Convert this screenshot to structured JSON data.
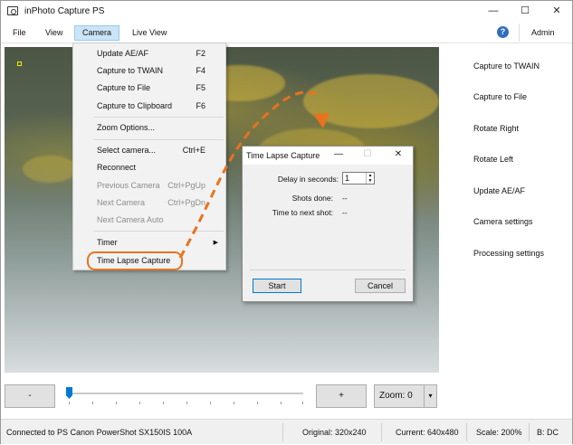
{
  "app": {
    "title": "inPhoto Capture PS"
  },
  "window_controls": {
    "minimize": "—",
    "maximize": "☐",
    "close": "✕"
  },
  "menubar": {
    "items": [
      "File",
      "View",
      "Camera",
      "Live View"
    ],
    "help": "?",
    "admin": "Admin"
  },
  "camera_menu": {
    "items": [
      {
        "label": "Update AE/AF",
        "shortcut": "F2",
        "enabled": true
      },
      {
        "label": "Capture to TWAIN",
        "shortcut": "F4",
        "enabled": true
      },
      {
        "label": "Capture to File",
        "shortcut": "F5",
        "enabled": true
      },
      {
        "label": "Capture to Clipboard",
        "shortcut": "F6",
        "enabled": true
      },
      {
        "label": "Zoom Options...",
        "shortcut": "",
        "enabled": true
      },
      {
        "label": "Select camera...",
        "shortcut": "Ctrl+E",
        "enabled": true
      },
      {
        "label": "Reconnect",
        "shortcut": "",
        "enabled": true
      },
      {
        "label": "Previous Camera",
        "shortcut": "Ctrl+PgUp",
        "enabled": false
      },
      {
        "label": "Next Camera",
        "shortcut": "Ctrl+PgDn",
        "enabled": false
      },
      {
        "label": "Next Camera Auto",
        "shortcut": "",
        "enabled": false
      },
      {
        "label": "Timer",
        "shortcut": "",
        "enabled": true
      },
      {
        "label": "Time Lapse Capture",
        "shortcut": "",
        "enabled": true
      }
    ]
  },
  "sidebar": {
    "items": [
      "Capture to TWAIN",
      "Capture to File",
      "Rotate Right",
      "Rotate Left",
      "Update AE/AF",
      "Camera settings",
      "Processing settings"
    ]
  },
  "controls": {
    "minus": "-",
    "plus": "+",
    "zoom": "Zoom: 0",
    "slider_fraction": 0.0
  },
  "dialog": {
    "title": "Time Lapse Capture",
    "delay_label": "Delay in seconds:",
    "delay_value": "1",
    "shots_label": "Shots done:",
    "shots_value": "--",
    "next_label": "Time to next shot:",
    "next_value": "--",
    "start": "Start",
    "cancel": "Cancel"
  },
  "status": {
    "connection": "Connected to PS Canon PowerShot SX150IS 100A",
    "original": "Original: 320x240",
    "current": "Current: 640x480",
    "scale": "Scale: 200%",
    "b": "B: DC"
  },
  "colors": {
    "accent": "#0078d7",
    "callout": "#e8731e",
    "menu_active": "#cce4f7"
  }
}
